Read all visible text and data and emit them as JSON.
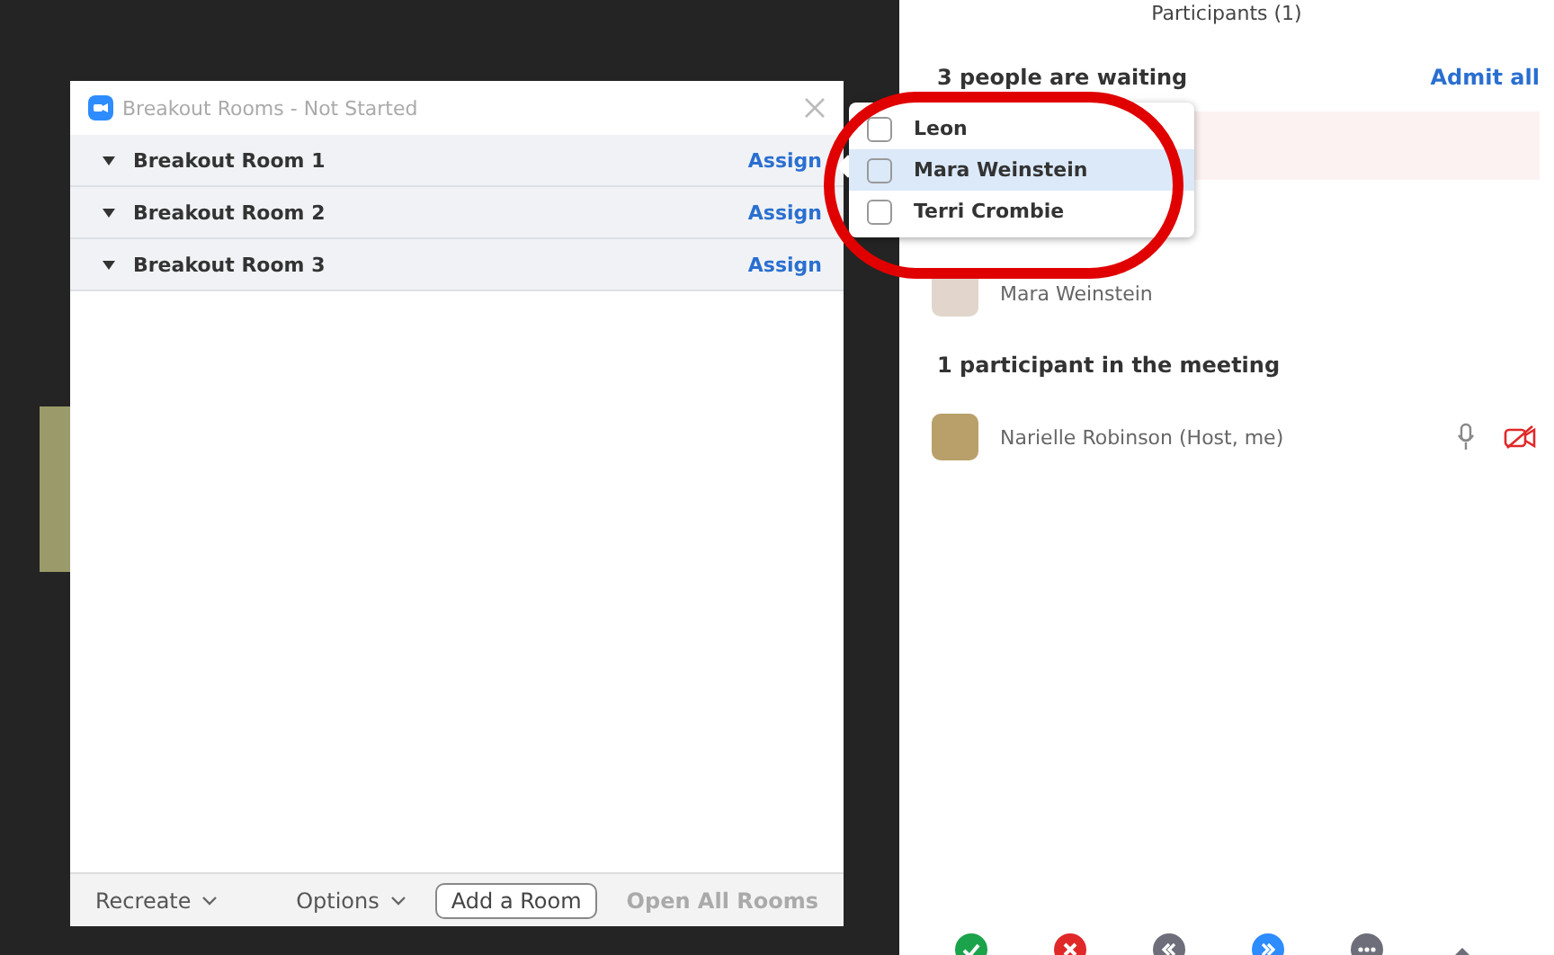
{
  "dialog": {
    "title": "Breakout Rooms - Not Started",
    "rooms": [
      {
        "name": "Breakout Room 1",
        "action": "Assign"
      },
      {
        "name": "Breakout Room 2",
        "action": "Assign"
      },
      {
        "name": "Breakout Room 3",
        "action": "Assign"
      }
    ],
    "footer": {
      "recreate": "Recreate",
      "options": "Options",
      "add_room": "Add a Room",
      "open_all": {
        "label": "Open All Rooms",
        "disabled": true
      }
    }
  },
  "assign_popup": {
    "items": [
      {
        "name": "Leon",
        "checked": false,
        "selected": false
      },
      {
        "name": "Mara Weinstein",
        "checked": false,
        "selected": true
      },
      {
        "name": "Terri Crombie",
        "checked": false,
        "selected": false
      }
    ]
  },
  "participants": {
    "title": "Participants (1)",
    "waiting_heading": "3 people are waiting",
    "admit_all": "Admit all",
    "waiting": [
      {
        "name": "Mara Weinstein"
      }
    ],
    "in_meeting_heading": "1 participant in the meeting",
    "in_meeting": [
      {
        "name": "Narielle Robinson (Host, me)",
        "video_off": true
      }
    ]
  }
}
